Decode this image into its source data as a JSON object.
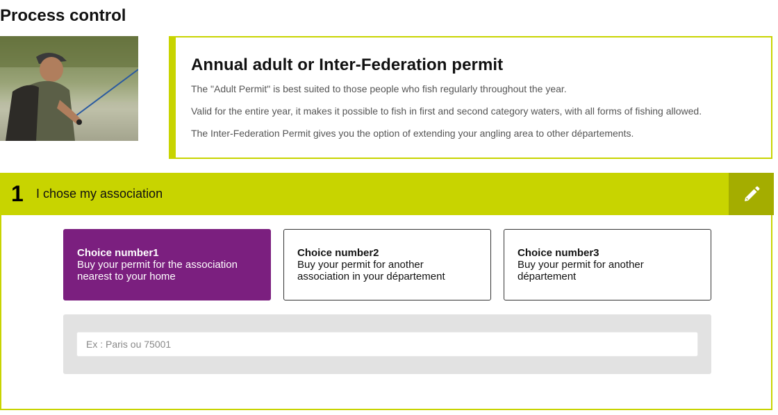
{
  "page": {
    "title": "Process control"
  },
  "intro": {
    "title": "Annual adult or Inter-Federation permit",
    "paragraphs": [
      "The \"Adult Permit\" is best suited to those people who fish regularly throughout the year.",
      "Valid for the entire year, it makes it possible to fish in first and second category waters, with all forms of fishing allowed.",
      "The Inter-Federation Permit gives you the option of extending your angling area to other départements."
    ],
    "accent_color": "#c8d400"
  },
  "step": {
    "number": "1",
    "label": "I chose my association",
    "edit_icon": "pencil-icon",
    "header_color": "#c8d400",
    "edit_bg_color": "#a4ad00"
  },
  "choices": [
    {
      "title": "Choice number1",
      "desc": "Buy your permit for the association nearest to your home",
      "selected": true
    },
    {
      "title": "Choice number2",
      "desc": "Buy your permit for another association in your département",
      "selected": false
    },
    {
      "title": "Choice number3",
      "desc": "Buy your permit for another département",
      "selected": false
    }
  ],
  "selected_color": "#7b1f7f",
  "search": {
    "placeholder": "Ex : Paris ou 75001",
    "value": ""
  }
}
